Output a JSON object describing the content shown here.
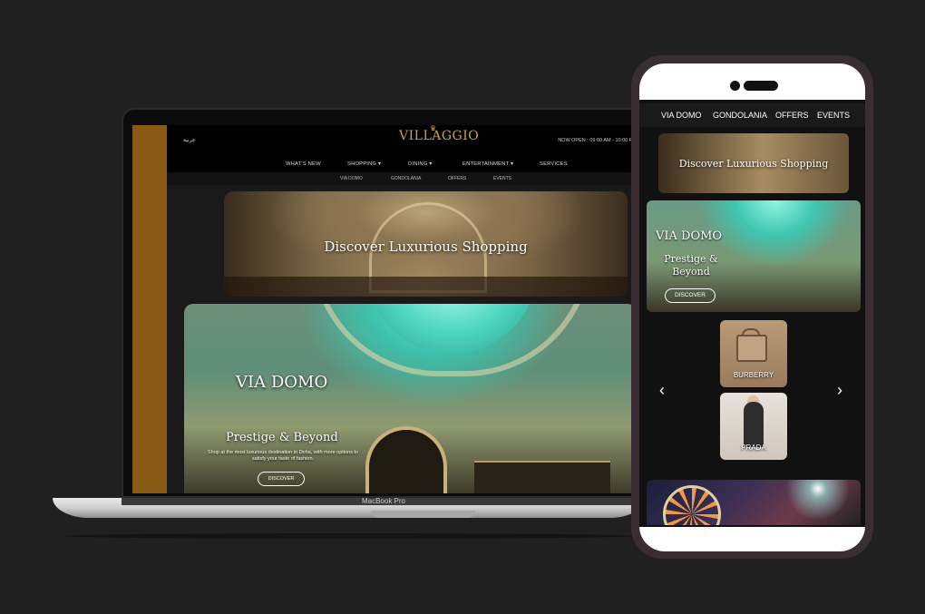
{
  "laptop": {
    "header": {
      "arabic_link": "عربية",
      "logo": "VILLAGGIO",
      "open_hours": "NOW OPEN : 09:00 AM - 10:00 PM"
    },
    "main_nav": [
      "WHAT'S NEW",
      "SHOPPING ▾",
      "DINING ▾",
      "ENTERTAINMENT ▾",
      "SERVICES"
    ],
    "sub_nav": [
      "VIA DOMO",
      "GONDOLANIA",
      "OFFERS",
      "EVENTS"
    ],
    "hero_small_title": "Discover Luxurious Shopping",
    "hero_big": {
      "title": "VIA DOMO",
      "subtitle": "Prestige & Beyond",
      "description": "Shop at the most luxurious destination in Doha, with more options to satisfy your taste of fashion.",
      "button": "DISCOVER"
    },
    "model_label": "MacBook Pro"
  },
  "phone": {
    "nav": [
      "VIA DOMO",
      "GONDOLANIA",
      "OFFERS",
      "EVENTS"
    ],
    "card1_title": "Discover Luxurious Shopping",
    "card2": {
      "title": "VIA DOMO",
      "subtitle": "Prestige & Beyond",
      "button": "DISCOVER"
    },
    "brands": [
      "BURBERRY",
      "PRADA"
    ],
    "prev_arrow": "‹",
    "next_arrow": "›"
  }
}
